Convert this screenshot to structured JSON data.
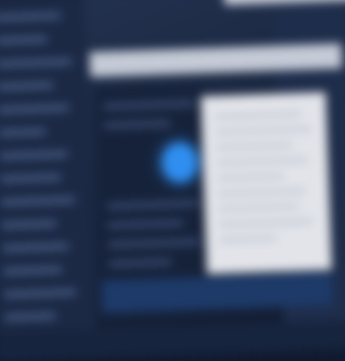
{
  "colors": {
    "background": "#0f1a2e",
    "sidebar": "#1b2945",
    "accent": "#2f8ef0",
    "card": "#e2e4ea",
    "header": "#c4cad6"
  },
  "screen": {
    "blurred": true
  }
}
